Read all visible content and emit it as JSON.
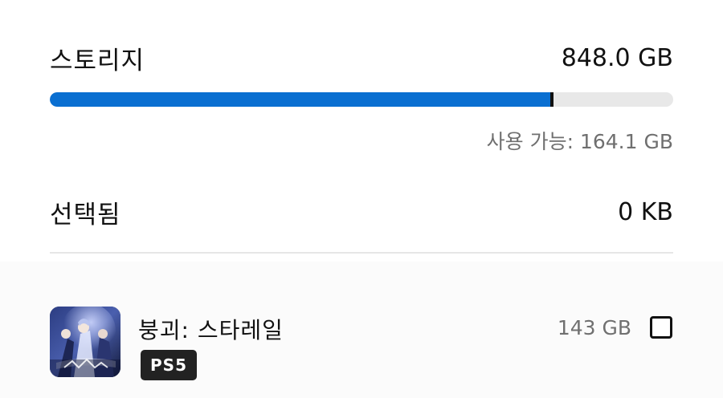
{
  "storage": {
    "title": "스토리지",
    "total": "848.0 GB",
    "available_label": "사용 가능: 164.1 GB",
    "used_fraction": 0.806,
    "bar_color": "#0a6fd1"
  },
  "selected": {
    "title": "선택됨",
    "value": "0 KB"
  },
  "games": [
    {
      "title": "붕괴: 스타레일",
      "platform": "PS5",
      "size": "143 GB",
      "checked": false,
      "icon": "game-thumbnail-icon"
    }
  ]
}
